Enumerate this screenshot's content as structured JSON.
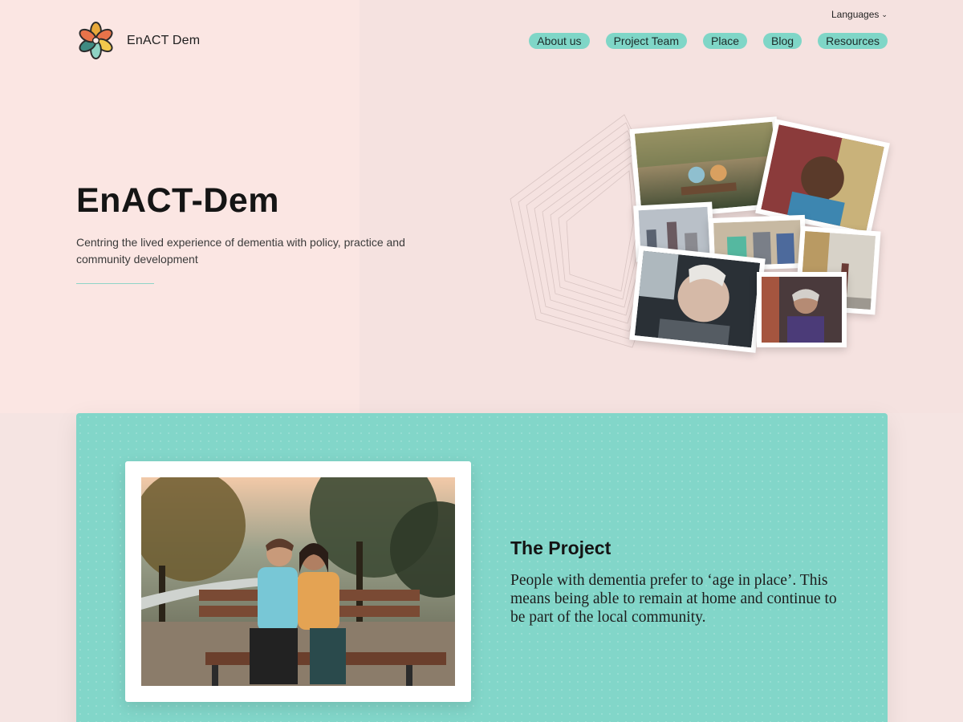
{
  "header": {
    "languages_label": "Languages",
    "logo_text": "EnACT Dem",
    "nav": [
      "About us",
      "Project Team",
      "Place",
      "Blog",
      "Resources"
    ]
  },
  "hero": {
    "title": "EnACT-Dem",
    "subtitle": "Centring the lived experience of dementia with policy, practice and community development"
  },
  "project": {
    "title": "The Project",
    "text": "People with dementia prefer to ‘age in place’. This means being able to remain at home and continue to be part of the local community."
  },
  "colors": {
    "accent_teal": "#82d6c9",
    "nav_pill": "#7fd6c7",
    "page_bg": "#fbe6e3",
    "logo_petals": [
      "#e8a93a",
      "#e8734a",
      "#3f8a82",
      "#8fd3c4",
      "#f2c94c"
    ]
  },
  "icons": {
    "logo": "flower-logo-icon",
    "languages": "chevron-down-icon"
  }
}
